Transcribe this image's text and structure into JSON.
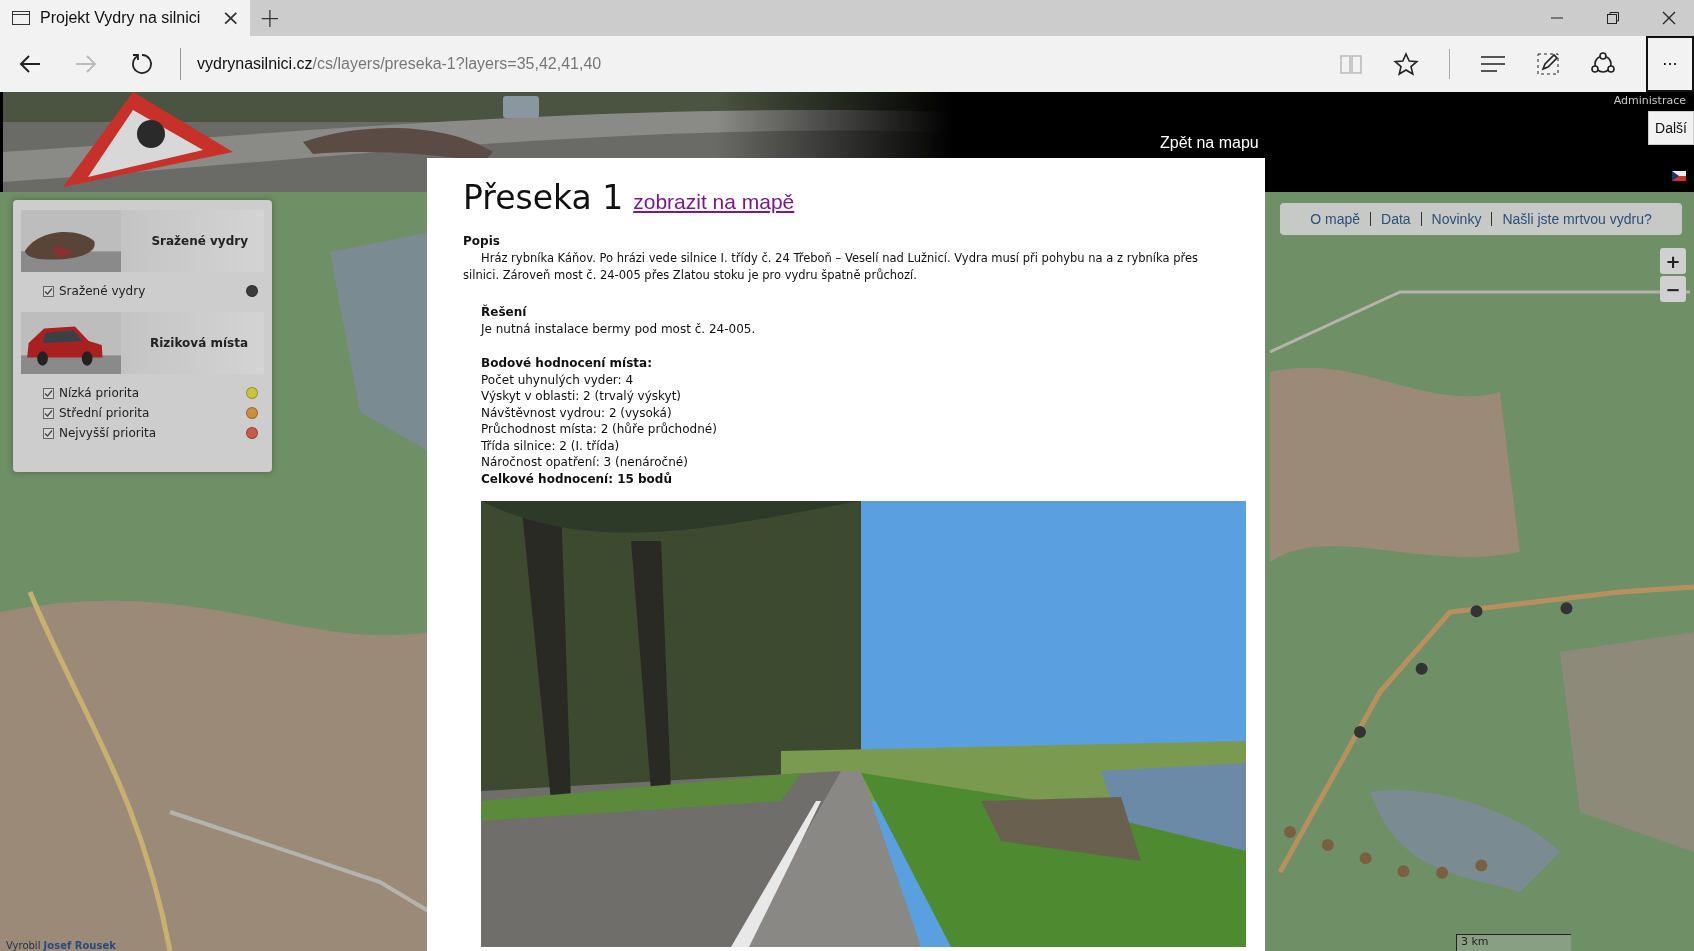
{
  "browser": {
    "tab_title": "Projekt Vydry na silnici",
    "tab_close": "×",
    "new_tab": "+",
    "address": {
      "domain": "vydrynasilnici.cz",
      "path": "/cs/layers/preseka-1?layers=35,42,41,40"
    },
    "more_button": "···",
    "tooltip": "Další"
  },
  "header": {
    "admin_link": "Administrace",
    "back_link": "Zpět na mapu"
  },
  "nav": [
    "O mapě",
    "Data",
    "Novinky",
    "Našli jste mrtvou vydru?"
  ],
  "legend": [
    {
      "title": "Sražené vydry",
      "kind": "otter",
      "items": [
        {
          "label": "Sražené vydry",
          "checked": true,
          "color": "#3a3a3a"
        }
      ]
    },
    {
      "title": "Riziková místa",
      "kind": "car",
      "items": [
        {
          "label": "Nízká priorita",
          "checked": true,
          "color": "#c8c43c"
        },
        {
          "label": "Střední priorita",
          "checked": true,
          "color": "#c8903c"
        },
        {
          "label": "Nejvyšší priorita",
          "checked": true,
          "color": "#c85a48"
        }
      ]
    }
  ],
  "map": {
    "zoom_in": "+",
    "zoom_out": "−",
    "scale": "3 km",
    "credit": "Vyrobil **Josef Rousek**"
  },
  "content": {
    "title": "Přeseka 1",
    "map_link": "zobrazit na mapě",
    "description_heading": "Popis",
    "description": "Hráz rybníka Káňov. Po hrázi vede silnice I. třídy č. 24 Třeboň – Veselí nad Lužnicí. Vydra musí při pohybu na a z rybníka přes silnici. Zároveň most č. 24-005 přes Zlatou stoku je pro vydru špatně průchozí.",
    "solution_heading": "Řešení",
    "solution": "Je nutná instalace bermy pod most č. 24-005.",
    "rating_heading": "Bodové hodnocení místa:",
    "rating_lines": [
      {
        "text": "Počet uhynulých vyder: 4",
        "kind": "plain"
      },
      {
        "text": "Výskyt v oblasti: 2 (trvalý výskyt)",
        "kind": "plain"
      },
      {
        "text": "Návštěvnost vydrou: 2 (vysoká)",
        "kind": "plain"
      },
      {
        "text": "Průchodnost místa: 2 (hůře průchodné)",
        "kind": "plain"
      },
      {
        "text": "Třída silnice: 2 (I. třída)",
        "kind": "plain"
      },
      {
        "text": "Náročnost opatření: 3 (nenáročné)",
        "kind": "plain"
      },
      {
        "text": "Celkové hodnocení: 15 bodů",
        "kind": "total"
      }
    ]
  }
}
